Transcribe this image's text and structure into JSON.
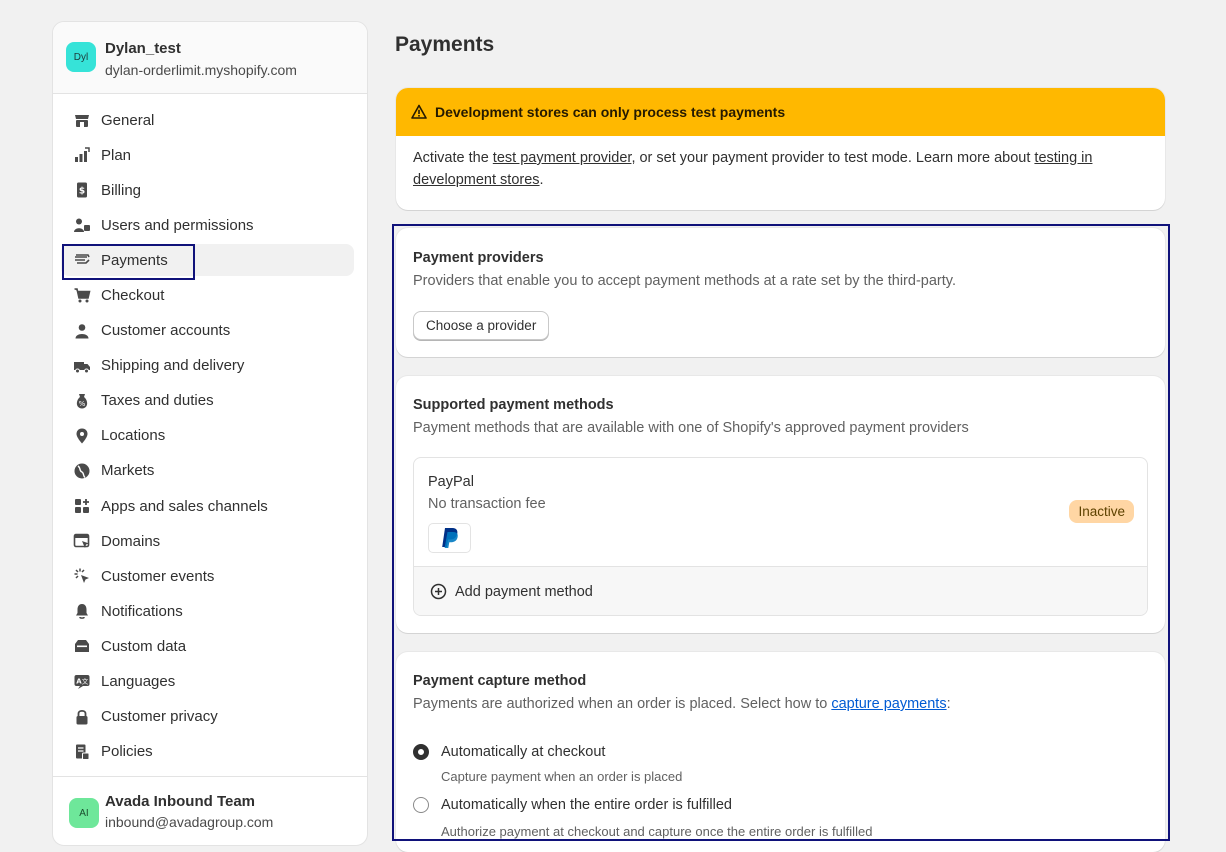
{
  "store": {
    "avatar": "Dyl",
    "name": "Dylan_test",
    "domain": "dylan-orderlimit.myshopify.com"
  },
  "nav": [
    {
      "label": "General",
      "icon": "store-icon"
    },
    {
      "label": "Plan",
      "icon": "plan-icon"
    },
    {
      "label": "Billing",
      "icon": "billing-icon"
    },
    {
      "label": "Users and permissions",
      "icon": "users-icon"
    },
    {
      "label": "Payments",
      "icon": "payments-icon",
      "active": true
    },
    {
      "label": "Checkout",
      "icon": "cart-icon"
    },
    {
      "label": "Customer accounts",
      "icon": "person-icon"
    },
    {
      "label": "Shipping and delivery",
      "icon": "truck-icon"
    },
    {
      "label": "Taxes and duties",
      "icon": "tax-icon"
    },
    {
      "label": "Locations",
      "icon": "location-icon"
    },
    {
      "label": "Markets",
      "icon": "globe-icon"
    },
    {
      "label": "Apps and sales channels",
      "icon": "apps-icon"
    },
    {
      "label": "Domains",
      "icon": "domains-icon"
    },
    {
      "label": "Customer events",
      "icon": "cursor-icon"
    },
    {
      "label": "Notifications",
      "icon": "bell-icon"
    },
    {
      "label": "Custom data",
      "icon": "data-icon"
    },
    {
      "label": "Languages",
      "icon": "language-icon"
    },
    {
      "label": "Customer privacy",
      "icon": "lock-icon"
    },
    {
      "label": "Policies",
      "icon": "policy-icon"
    }
  ],
  "user": {
    "avatar": "AI",
    "name": "Avada Inbound Team",
    "email": "inbound@avadagroup.com"
  },
  "page": {
    "title": "Payments"
  },
  "banner": {
    "title": "Development stores can only process test payments",
    "text_1": "Activate the ",
    "link_1": "test payment provider",
    "text_2": ", or set your payment provider to test mode. Learn more about ",
    "link_2": "testing in development stores",
    "text_3": "."
  },
  "providers": {
    "title": "Payment providers",
    "subtitle": "Providers that enable you to accept payment methods at a rate set by the third-party.",
    "button": "Choose a provider"
  },
  "methods": {
    "title": "Supported payment methods",
    "subtitle": "Payment methods that are available with one of Shopify's approved payment providers",
    "item": {
      "name": "PayPal",
      "fee": "No transaction fee",
      "status": "Inactive"
    },
    "add": "Add payment method"
  },
  "capture": {
    "title": "Payment capture method",
    "subtitle": "Payments are authorized when an order is placed. Select how to ",
    "subtitle_link": "capture payments",
    "subtitle_end": ":",
    "options": [
      {
        "label": "Automatically at checkout",
        "help": "Capture payment when an order is placed",
        "checked": true
      },
      {
        "label": "Automatically when the entire order is fulfilled",
        "help": "Authorize payment at checkout and capture once the entire order is fulfilled",
        "checked": false
      }
    ]
  },
  "colors": {
    "accent_warning": "#ffb800",
    "highlight": "#10127a",
    "link": "#005bd3"
  }
}
